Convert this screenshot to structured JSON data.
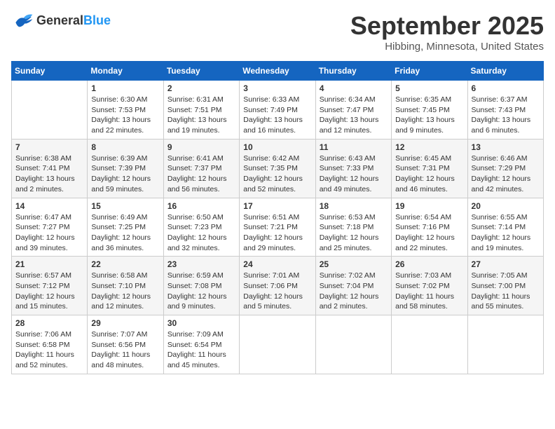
{
  "logo": {
    "line1": "General",
    "line2": "Blue"
  },
  "title": "September 2025",
  "location": "Hibbing, Minnesota, United States",
  "days_of_week": [
    "Sunday",
    "Monday",
    "Tuesday",
    "Wednesday",
    "Thursday",
    "Friday",
    "Saturday"
  ],
  "weeks": [
    [
      {
        "day": "",
        "info": ""
      },
      {
        "day": "1",
        "info": "Sunrise: 6:30 AM\nSunset: 7:53 PM\nDaylight: 13 hours\nand 22 minutes."
      },
      {
        "day": "2",
        "info": "Sunrise: 6:31 AM\nSunset: 7:51 PM\nDaylight: 13 hours\nand 19 minutes."
      },
      {
        "day": "3",
        "info": "Sunrise: 6:33 AM\nSunset: 7:49 PM\nDaylight: 13 hours\nand 16 minutes."
      },
      {
        "day": "4",
        "info": "Sunrise: 6:34 AM\nSunset: 7:47 PM\nDaylight: 13 hours\nand 12 minutes."
      },
      {
        "day": "5",
        "info": "Sunrise: 6:35 AM\nSunset: 7:45 PM\nDaylight: 13 hours\nand 9 minutes."
      },
      {
        "day": "6",
        "info": "Sunrise: 6:37 AM\nSunset: 7:43 PM\nDaylight: 13 hours\nand 6 minutes."
      }
    ],
    [
      {
        "day": "7",
        "info": "Sunrise: 6:38 AM\nSunset: 7:41 PM\nDaylight: 13 hours\nand 2 minutes."
      },
      {
        "day": "8",
        "info": "Sunrise: 6:39 AM\nSunset: 7:39 PM\nDaylight: 12 hours\nand 59 minutes."
      },
      {
        "day": "9",
        "info": "Sunrise: 6:41 AM\nSunset: 7:37 PM\nDaylight: 12 hours\nand 56 minutes."
      },
      {
        "day": "10",
        "info": "Sunrise: 6:42 AM\nSunset: 7:35 PM\nDaylight: 12 hours\nand 52 minutes."
      },
      {
        "day": "11",
        "info": "Sunrise: 6:43 AM\nSunset: 7:33 PM\nDaylight: 12 hours\nand 49 minutes."
      },
      {
        "day": "12",
        "info": "Sunrise: 6:45 AM\nSunset: 7:31 PM\nDaylight: 12 hours\nand 46 minutes."
      },
      {
        "day": "13",
        "info": "Sunrise: 6:46 AM\nSunset: 7:29 PM\nDaylight: 12 hours\nand 42 minutes."
      }
    ],
    [
      {
        "day": "14",
        "info": "Sunrise: 6:47 AM\nSunset: 7:27 PM\nDaylight: 12 hours\nand 39 minutes."
      },
      {
        "day": "15",
        "info": "Sunrise: 6:49 AM\nSunset: 7:25 PM\nDaylight: 12 hours\nand 36 minutes."
      },
      {
        "day": "16",
        "info": "Sunrise: 6:50 AM\nSunset: 7:23 PM\nDaylight: 12 hours\nand 32 minutes."
      },
      {
        "day": "17",
        "info": "Sunrise: 6:51 AM\nSunset: 7:21 PM\nDaylight: 12 hours\nand 29 minutes."
      },
      {
        "day": "18",
        "info": "Sunrise: 6:53 AM\nSunset: 7:18 PM\nDaylight: 12 hours\nand 25 minutes."
      },
      {
        "day": "19",
        "info": "Sunrise: 6:54 AM\nSunset: 7:16 PM\nDaylight: 12 hours\nand 22 minutes."
      },
      {
        "day": "20",
        "info": "Sunrise: 6:55 AM\nSunset: 7:14 PM\nDaylight: 12 hours\nand 19 minutes."
      }
    ],
    [
      {
        "day": "21",
        "info": "Sunrise: 6:57 AM\nSunset: 7:12 PM\nDaylight: 12 hours\nand 15 minutes."
      },
      {
        "day": "22",
        "info": "Sunrise: 6:58 AM\nSunset: 7:10 PM\nDaylight: 12 hours\nand 12 minutes."
      },
      {
        "day": "23",
        "info": "Sunrise: 6:59 AM\nSunset: 7:08 PM\nDaylight: 12 hours\nand 9 minutes."
      },
      {
        "day": "24",
        "info": "Sunrise: 7:01 AM\nSunset: 7:06 PM\nDaylight: 12 hours\nand 5 minutes."
      },
      {
        "day": "25",
        "info": "Sunrise: 7:02 AM\nSunset: 7:04 PM\nDaylight: 12 hours\nand 2 minutes."
      },
      {
        "day": "26",
        "info": "Sunrise: 7:03 AM\nSunset: 7:02 PM\nDaylight: 11 hours\nand 58 minutes."
      },
      {
        "day": "27",
        "info": "Sunrise: 7:05 AM\nSunset: 7:00 PM\nDaylight: 11 hours\nand 55 minutes."
      }
    ],
    [
      {
        "day": "28",
        "info": "Sunrise: 7:06 AM\nSunset: 6:58 PM\nDaylight: 11 hours\nand 52 minutes."
      },
      {
        "day": "29",
        "info": "Sunrise: 7:07 AM\nSunset: 6:56 PM\nDaylight: 11 hours\nand 48 minutes."
      },
      {
        "day": "30",
        "info": "Sunrise: 7:09 AM\nSunset: 6:54 PM\nDaylight: 11 hours\nand 45 minutes."
      },
      {
        "day": "",
        "info": ""
      },
      {
        "day": "",
        "info": ""
      },
      {
        "day": "",
        "info": ""
      },
      {
        "day": "",
        "info": ""
      }
    ]
  ]
}
